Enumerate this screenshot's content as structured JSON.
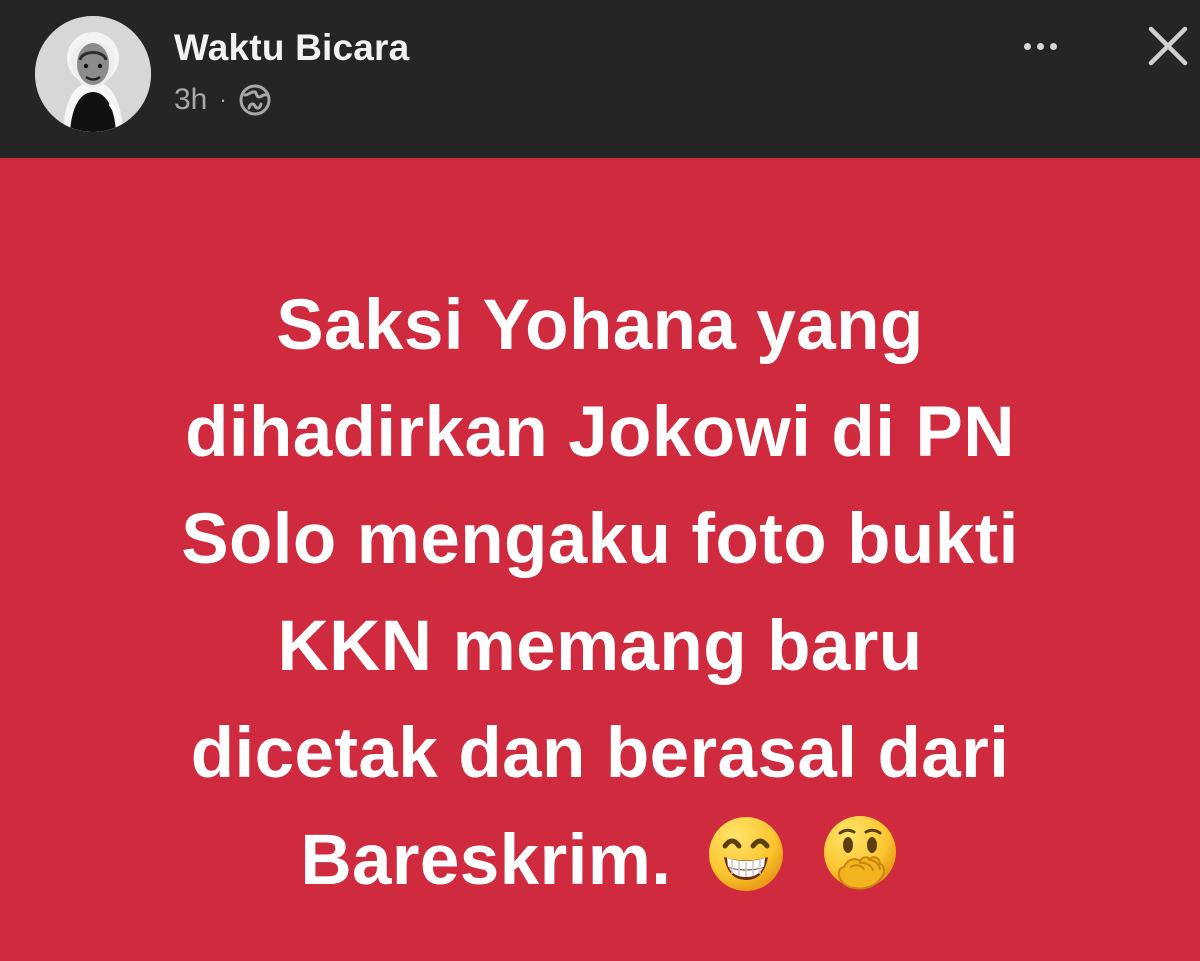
{
  "post": {
    "author_name": "Waktu Bicara",
    "time": "3h",
    "separator": "·",
    "privacy_icon": "globe-icon",
    "menu_icon": "more-options-icon",
    "close_icon": "close-icon",
    "text_lines": [
      "Saksi Yohana yang",
      "dihadirkan Jokowi di PN",
      "Solo mengaku foto bukti",
      "KKN memang baru",
      "dicetak dan berasal dari",
      "Bareskrim."
    ],
    "emojis": [
      "grinning-face-with-smiling-eyes-emoji",
      "face-with-hand-over-mouth-emoji"
    ]
  },
  "colors": {
    "header_background": "#252526",
    "post_background": "#cf2a3e",
    "post_text": "#ffffff",
    "author_text": "#f2f2f2",
    "meta_text": "#a8a8a8"
  }
}
